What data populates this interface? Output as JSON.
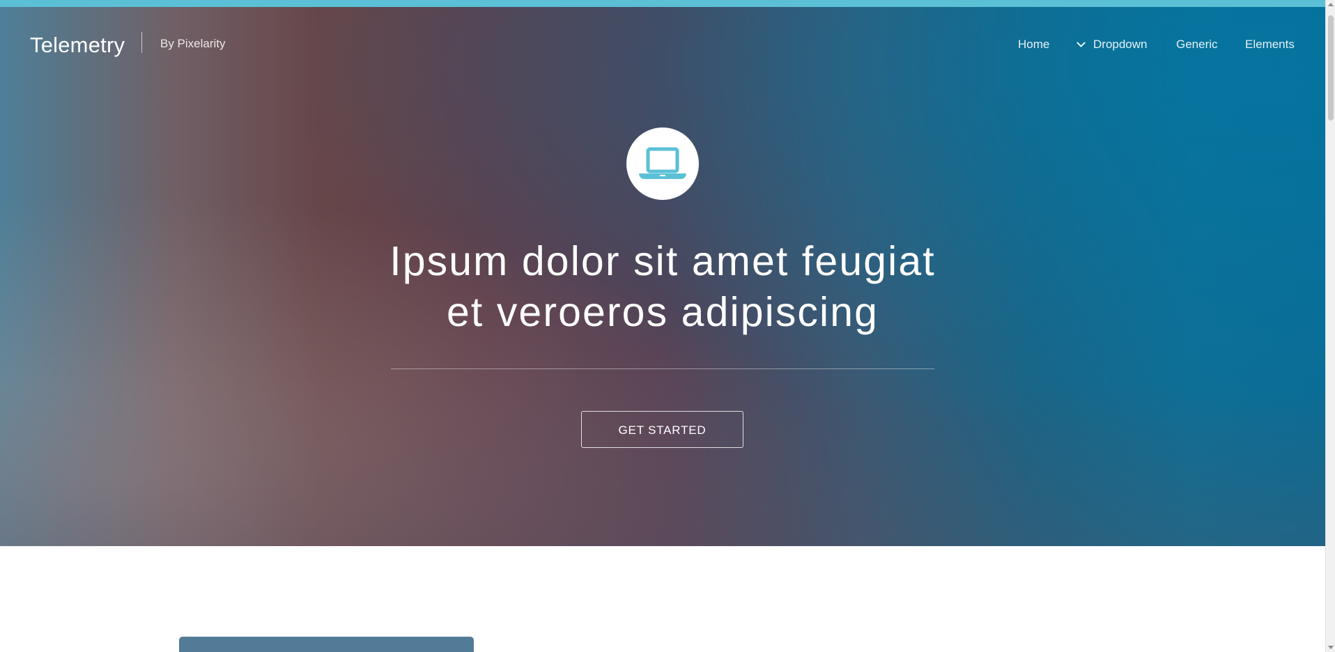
{
  "site": {
    "brand": "Telemetry",
    "byline": "By Pixelarity"
  },
  "navigation": {
    "items": [
      {
        "label": "Home"
      },
      {
        "label": "Dropdown"
      },
      {
        "label": "Generic"
      },
      {
        "label": "Elements"
      }
    ]
  },
  "hero": {
    "icon": "laptop-icon",
    "title_line_1": "Ipsum dolor sit amet feugiat",
    "title_line_2": "et veroeros adipiscing",
    "button_label": "GET STARTED"
  },
  "colors": {
    "accent": "#5bc0d6",
    "hero_left": "#4e7f98",
    "hero_center": "#5f3f4b",
    "hero_right": "#0b6c95",
    "white": "#ffffff",
    "section_card": "#527b98"
  }
}
